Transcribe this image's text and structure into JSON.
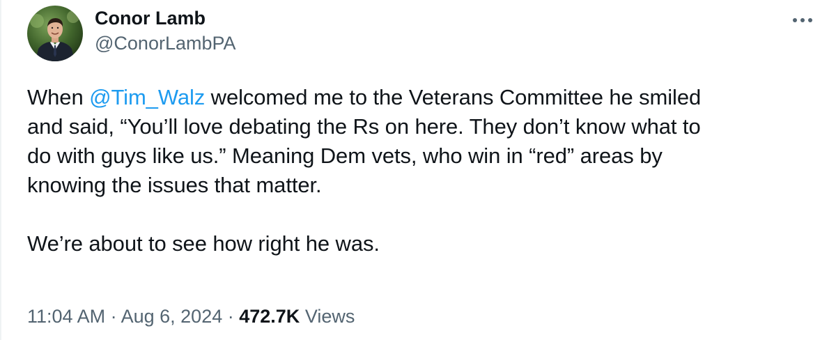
{
  "author": {
    "display_name": "Conor Lamb",
    "handle": "@ConorLambPA"
  },
  "tweet": {
    "line1_before": "When ",
    "mention": "@Tim_Walz",
    "line1_after": " welcomed me to the Veterans Committee he smiled",
    "line2": "and said, “You’ll love debating the Rs on here.  They don’t know what to",
    "line3": "do with guys like us.”  Meaning Dem vets, who win in “red” areas by",
    "line4": "knowing the issues that matter.",
    "line5": "We’re about to see how right he was."
  },
  "meta": {
    "time": "11:04 AM",
    "separator": " · ",
    "date": "Aug 6, 2024",
    "views_count": "472.7K",
    "views_label": " Views"
  },
  "icons": {
    "more": "more-horizontal-icon",
    "avatar": "avatar-photo"
  },
  "colors": {
    "link": "#1d9bf0",
    "secondary_text": "#536471",
    "primary_text": "#0f1419"
  }
}
